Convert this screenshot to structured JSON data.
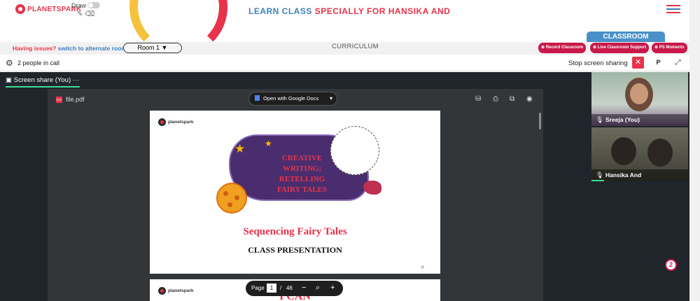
{
  "header": {
    "logo_text": "PLANETSPARK",
    "draw_label": "Draw",
    "banner_part1": "LEARN CLASS",
    "banner_part2": "SPECIALLY FOR HANSIKA AND",
    "menu_icon": "hamburger-icon",
    "classroom_tab": "CLASSROOM"
  },
  "room_bar": {
    "issues_text": "Having issues?",
    "alternate_link": "switch to alternate room",
    "room_select": "Room 1",
    "curriculum": "CURRICULUM",
    "record_btn": "Record Classroom",
    "support_btn": "Live Classroom Support",
    "moments_btn": "PS Moments"
  },
  "call_bar": {
    "people_count": "2 people in call",
    "stop_sharing": "Stop screen sharing",
    "p_button": "P"
  },
  "screen_share": {
    "title": "Screen share (You)",
    "more": "···"
  },
  "viewer": {
    "file_name": "file.pdf",
    "open_with": "Open with Google Docs",
    "page_label": "Page",
    "current_page": "1",
    "separator": "/",
    "total_pages": "46"
  },
  "slide": {
    "logo_text": "planetspark",
    "title_line1": "CREATIVE",
    "title_line2": "WRITING;",
    "title_line3": "RETELLING",
    "title_line4": "FAIRY TALES",
    "subtitle": "Sequencing Fairy Tales",
    "class_text": "CLASS PRESENTATION",
    "next_page_text": "I CAN"
  },
  "participants": [
    {
      "name": "Sreeja (You)"
    },
    {
      "name": "Hansika And"
    }
  ],
  "notification_badge": "2",
  "colors": {
    "brand_red": "#e8334a",
    "brand_blue": "#3f7fbf",
    "pill_crimson": "#c9184a",
    "accent_green": "#3ddc97",
    "slide_purple": "#4a2d6e"
  }
}
